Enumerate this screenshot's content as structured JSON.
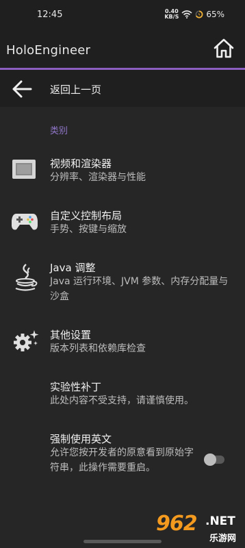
{
  "status": {
    "time": "12:45",
    "net_speed_value": "0.40",
    "net_speed_unit": "KB/S",
    "battery": "65%"
  },
  "app_bar": {
    "title": "HoloEngineer",
    "home_icon": "home-icon"
  },
  "back": {
    "label": "返回上一页",
    "icon": "arrow-left-icon"
  },
  "category": "类别",
  "items": [
    {
      "title": "视频和渲染器",
      "subtitle": "分辨率、渲染器与性能",
      "icon": "screen-icon"
    },
    {
      "title": "自定义控制布局",
      "subtitle": "手势、按键与缩放",
      "icon": "gamepad-icon"
    },
    {
      "title": "Java 调整",
      "subtitle": "Java 运行环境、JVM 参数、内存分配量与沙盒",
      "icon": "java-icon"
    },
    {
      "title": "其他设置",
      "subtitle": "版本列表和依赖库检查",
      "icon": "gear-sparkle-icon"
    },
    {
      "title": "实验性补丁",
      "subtitle": "此处内容不受支持，请谨慎使用。"
    },
    {
      "title": "强制使用英文",
      "subtitle": "允许您按开发者的原意看到原始字符串，此操作需要重启。",
      "toggle": false
    }
  ],
  "watermark": {
    "number": "962",
    "net": ".NET",
    "sub": "乐游网"
  },
  "colors": {
    "accent": "#8c5ec0",
    "category": "#8f75c7",
    "background": "#262626",
    "bar": "#1f1f1f"
  }
}
